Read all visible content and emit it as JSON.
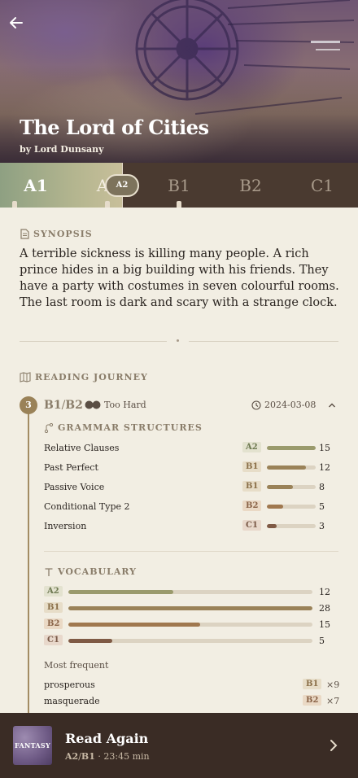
{
  "book": {
    "title": "The Lord of Cities",
    "author": "by Lord Dunsany"
  },
  "levels": {
    "tabs": [
      "A1",
      "A",
      "B1",
      "B2",
      "C1"
    ],
    "current_pill": "A2"
  },
  "synopsis": {
    "label": "SYNOPSIS",
    "text": "A terrible sickness is killing many people. A rich prince hides in a big building with his friends. They have a party with costumes in seven colourful rooms. The last room is dark and scary with a strange clock."
  },
  "journey": {
    "label": "READING JOURNEY",
    "entry": {
      "step": "3",
      "level_from": "B1",
      "level_to": "B2",
      "difficulty": "Too Hard",
      "date": "2024-03-08"
    },
    "grammar": {
      "label": "GRAMMAR STRUCTURES",
      "items": [
        {
          "name": "Relative Clauses",
          "level": "A2",
          "count": "15",
          "fraction": 1.0
        },
        {
          "name": "Past Perfect",
          "level": "B1",
          "count": "12",
          "fraction": 0.8
        },
        {
          "name": "Passive Voice",
          "level": "B1",
          "count": "8",
          "fraction": 0.53
        },
        {
          "name": "Conditional Type 2",
          "level": "B2",
          "count": "5",
          "fraction": 0.33
        },
        {
          "name": "Inversion",
          "level": "C1",
          "count": "3",
          "fraction": 0.2
        }
      ]
    },
    "vocabulary": {
      "label": "VOCABULARY",
      "items": [
        {
          "level": "A2",
          "count": "12",
          "fraction": 0.43
        },
        {
          "level": "B1",
          "count": "28",
          "fraction": 1.0
        },
        {
          "level": "B2",
          "count": "15",
          "fraction": 0.54
        },
        {
          "level": "C1",
          "count": "5",
          "fraction": 0.18
        }
      ],
      "most_frequent_label": "Most frequent",
      "words": [
        {
          "word": "prosperous",
          "level": "B1",
          "times": "×9"
        },
        {
          "word": "masquerade",
          "level": "B2",
          "times": "×7"
        }
      ]
    }
  },
  "read_again": {
    "cover_text": "FANTASY",
    "title": "Read Again",
    "level_a": "A2",
    "level_b": "B1",
    "duration": "· 23:45 min"
  },
  "colors": {
    "a2": "#9a9a6c",
    "b1": "#9a8258",
    "b2": "#a0784f",
    "c1": "#7f5a45",
    "bg": "#f2eee3",
    "dark": "#3a2c25"
  }
}
